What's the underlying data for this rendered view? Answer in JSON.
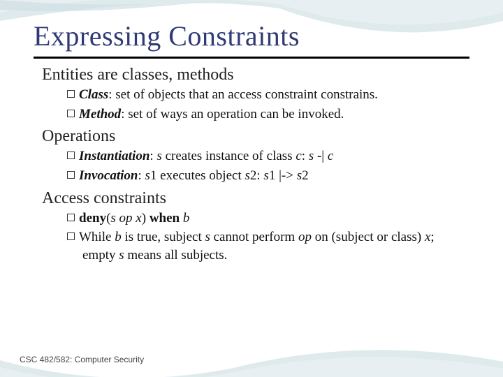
{
  "title": "Expressing Constraints",
  "sections": [
    {
      "heading": "Entities are classes, methods",
      "bullets": [
        {
          "term": "Class",
          "rest": ": set of objects that an access constraint constrains."
        },
        {
          "term": "Method",
          "rest": ": set of ways an operation can be invoked."
        }
      ]
    },
    {
      "heading": "Operations",
      "bullets": [
        {
          "term": "Instantiation",
          "rest_html": ": <span class=\"ital\">s</span> creates instance of class <span class=\"ital\">c</span>: <span class=\"ital\">s</span> -| <span class=\"ital\">c</span>"
        },
        {
          "term": "Invocation",
          "rest_html": ": <span class=\"ital\">s</span>1 executes object <span class=\"ital\">s</span>2: <span class=\"ital\">s</span>1 |-&gt; <span class=\"ital\">s</span>2"
        }
      ]
    },
    {
      "heading": "Access constraints",
      "bullets": [
        {
          "raw_html": "<span class=\"bold\">deny</span>(<span class=\"ital\">s op x</span>) <span class=\"bold\">when</span> <span class=\"ital\">b</span>"
        },
        {
          "raw_html": "While <span class=\"ital\">b</span> is true, subject <span class=\"ital\">s</span> cannot perform <span class=\"ital\">op</span> on (subject or class) <span class=\"ital\">x</span>; empty <span class=\"ital\">s</span> means all subjects."
        }
      ]
    }
  ],
  "footer": "CSC 482/582: Computer Security"
}
